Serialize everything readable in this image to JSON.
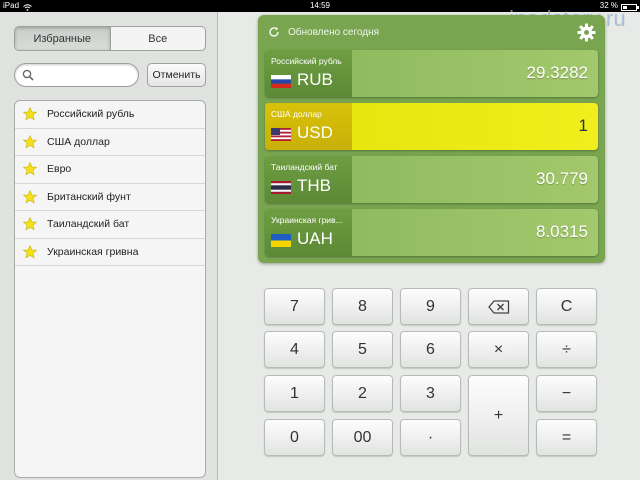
{
  "status_bar": {
    "device": "iPad",
    "time": "14:59",
    "battery_percent": "32 %",
    "battery_level": 0.32
  },
  "left_panel": {
    "segments": [
      {
        "label": "Избранные",
        "selected": true
      },
      {
        "label": "Все",
        "selected": false
      }
    ],
    "search": {
      "value": "",
      "placeholder": ""
    },
    "cancel_label": "Отменить",
    "items": [
      {
        "label": "Российский рубль",
        "icon": "star-icon"
      },
      {
        "label": "США доллар",
        "icon": "star-icon"
      },
      {
        "label": "Евро",
        "icon": "star-icon"
      },
      {
        "label": "Британский фунт",
        "icon": "star-icon"
      },
      {
        "label": "Таиландский бат",
        "icon": "star-icon"
      },
      {
        "label": "Украинская гривна",
        "icon": "star-icon"
      }
    ]
  },
  "rates_panel": {
    "updated_text": "Обновлено сегодня",
    "rows": [
      {
        "name": "Российский рубль",
        "code": "RUB",
        "value": "29.3282",
        "flag": "ru-flag",
        "active": false
      },
      {
        "name": "США доллар",
        "code": "USD",
        "value": "1",
        "flag": "us-flag",
        "active": true
      },
      {
        "name": "Таиландский бат",
        "code": "THB",
        "value": "30.779",
        "flag": "th-flag",
        "active": false
      },
      {
        "name": "Украинская грив...",
        "code": "UAH",
        "value": "8.0315",
        "flag": "ua-flag",
        "active": false
      }
    ]
  },
  "keypad": {
    "keys": [
      "7",
      "8",
      "9",
      "⌫",
      "C",
      "4",
      "5",
      "6",
      "×",
      "÷",
      "1",
      "2",
      "3",
      "+",
      "−",
      "0",
      "00",
      "·",
      "="
    ]
  },
  "watermark": "ipadstory.ru",
  "colors": {
    "panel_green": "#79a450",
    "row_green": "#8ab65a",
    "active_yellow": "#e4e30a",
    "star_yellow": "#f3e11a"
  }
}
